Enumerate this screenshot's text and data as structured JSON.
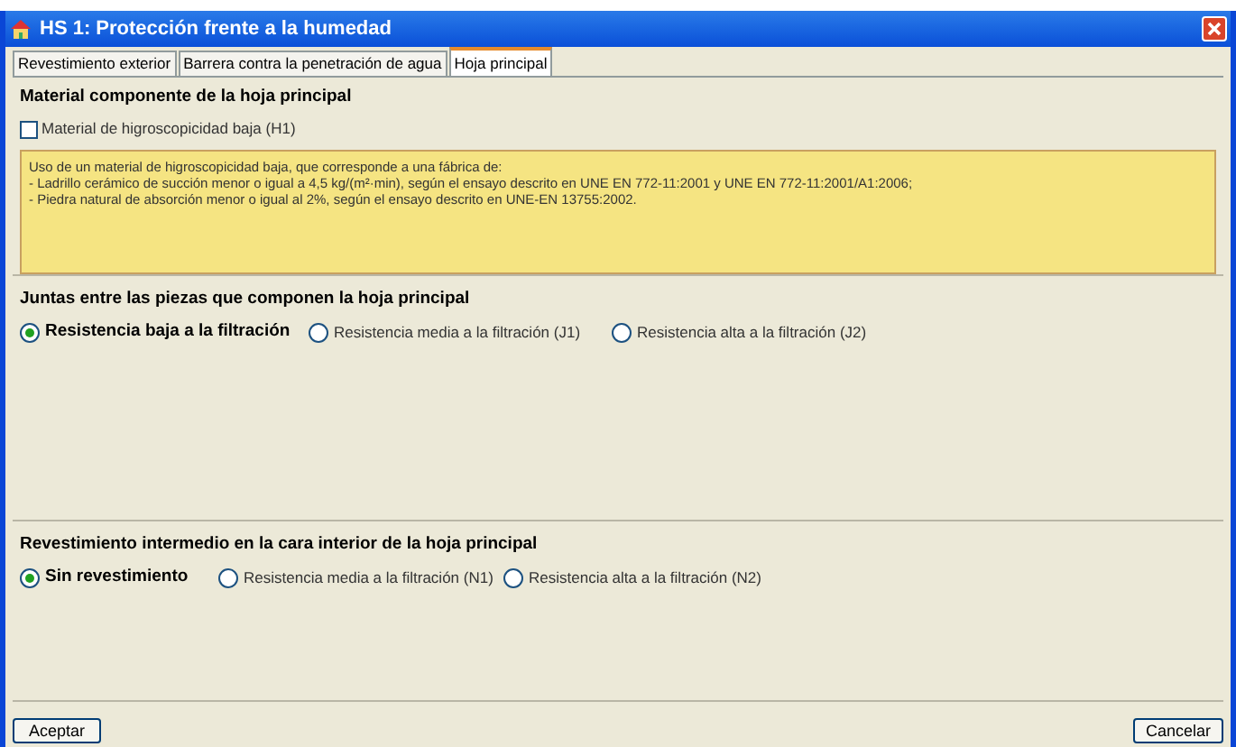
{
  "window": {
    "title": "HS 1: Protección frente a la humedad"
  },
  "tabs": [
    {
      "label": "Revestimiento exterior",
      "selected": false
    },
    {
      "label": "Barrera contra la penetración de agua",
      "selected": false
    },
    {
      "label": "Hoja principal",
      "selected": true
    }
  ],
  "material_section": {
    "heading": "Material componente de la hoja principal",
    "checkbox": {
      "label": "Material de higroscopicidad baja (H1)",
      "checked": false
    },
    "description": [
      "Uso de un material de higroscopicidad baja, que corresponde a una fábrica de:",
      "- Ladrillo cerámico de succión menor o igual a 4,5 kg/(m²·min), según el ensayo descrito en UNE EN 772-11:2001 y UNE EN 772-11:2001/A1:2006;",
      "- Piedra natural de absorción menor o igual al 2%, según el ensayo descrito en UNE-EN 13755:2002."
    ]
  },
  "groups": [
    {
      "heading": "Juntas entre las piezas que componen la hoja principal",
      "options": [
        {
          "label": "Resistencia baja a la filtración",
          "selected": true
        },
        {
          "label": "Resistencia media a la filtración (J1)",
          "selected": false
        },
        {
          "label": "Resistencia alta a la filtración (J2)",
          "selected": false
        }
      ]
    },
    {
      "heading": "Revestimiento intermedio en la cara interior de la hoja principal",
      "options": [
        {
          "label": "Sin revestimiento",
          "selected": true
        },
        {
          "label": "Resistencia media a la filtración (N1)",
          "selected": false
        },
        {
          "label": "Resistencia alta a la filtración (N2)",
          "selected": false
        }
      ]
    }
  ],
  "buttons": {
    "accept": "Aceptar",
    "cancel": "Cancelar"
  }
}
